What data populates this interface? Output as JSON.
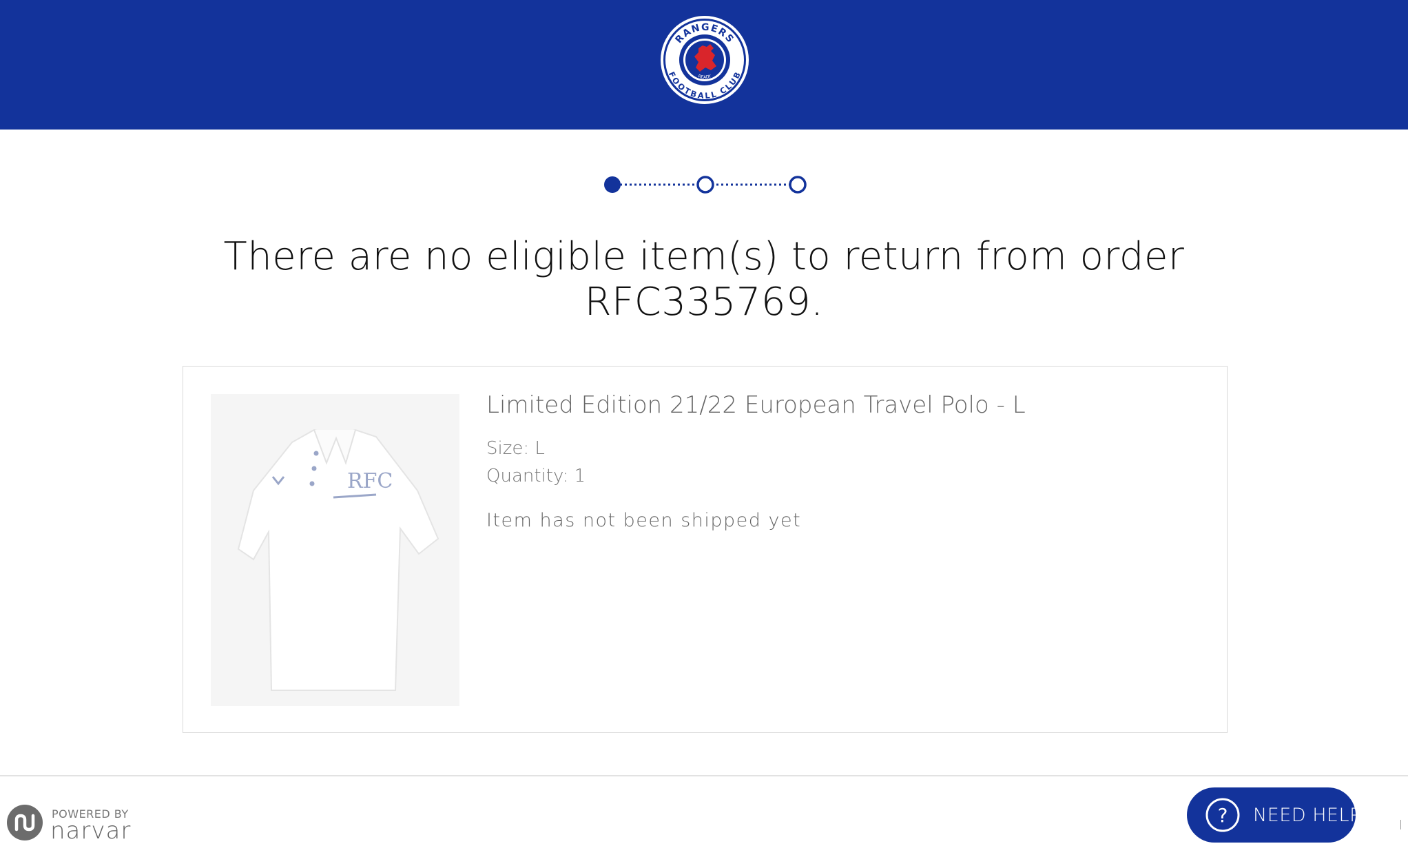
{
  "header": {
    "brand_color": "#13339b",
    "logo": {
      "icon": "rangers-fc-crest-icon",
      "top_text": "RANGERS",
      "bottom_text": "FOOTBALL CLUB",
      "motto": "READY"
    }
  },
  "stepper": {
    "steps_total": 3,
    "current_step": 1
  },
  "main": {
    "headline": "There are no eligible item(s) to return from order RFC335769."
  },
  "item": {
    "image_icon": "polo-shirt-image",
    "title": "Limited Edition 21/22 European Travel Polo - L",
    "size": "Size: L",
    "quantity": "Quantity: 1",
    "status": "Item has not been shipped yet"
  },
  "footer": {
    "powered_by": "POWERED BY",
    "brand": "narvar",
    "help_button": "NEED HELP",
    "help_icon": "question-circle-icon"
  }
}
